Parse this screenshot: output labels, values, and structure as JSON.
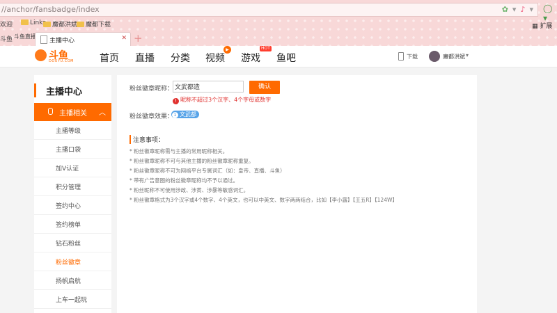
{
  "browser": {
    "address": "//anchor/fansbadge/index",
    "star_icon": "star-icon",
    "bookmarks": [
      {
        "label": "欢迎"
      },
      {
        "label": "Links"
      },
      {
        "label": "魔都洪斌"
      },
      {
        "label": "魔都下载"
      }
    ],
    "extensions_label": "扩展",
    "tabs": [
      {
        "label": "斗鱼"
      },
      {
        "label": "斗鱼直播"
      },
      {
        "label": "主播中心"
      }
    ]
  },
  "site": {
    "logo": {
      "main": "斗鱼",
      "sub": "DOUYU.COM"
    },
    "nav": [
      {
        "label": "首页"
      },
      {
        "label": "直播"
      },
      {
        "label": "分类"
      },
      {
        "label": "视频"
      },
      {
        "label": "游戏"
      },
      {
        "label": "鱼吧"
      }
    ],
    "hot_badge": "HOT",
    "download_label": "下载",
    "user_name": "魔都洪斌"
  },
  "sidebar": {
    "title": "主播中心",
    "section": "主播相关",
    "items": [
      {
        "label": "主播等级"
      },
      {
        "label": "主播口袋"
      },
      {
        "label": "加V认证"
      },
      {
        "label": "积分管理"
      },
      {
        "label": "签约中心"
      },
      {
        "label": "签约榜单"
      },
      {
        "label": "钻石粉丝"
      },
      {
        "label": "粉丝徽章"
      },
      {
        "label": "扬帆启航"
      },
      {
        "label": "上车一起玩"
      }
    ]
  },
  "form": {
    "name_label": "粉丝徽章昵称：",
    "name_value": "文武都造",
    "confirm_label": "确认",
    "warning": "昵称不超过3个汉字、4个字母或数字",
    "effect_label": "粉丝徽章效果：",
    "badge_level": "1",
    "badge_text": "文武都"
  },
  "notes": {
    "title": "注意事项：",
    "items": [
      "* 粉丝徽章昵称需与主播的常用昵称相关。",
      "* 粉丝徽章昵称不可与其他主播的粉丝徽章昵称重复。",
      "* 粉丝徽章昵称不可为网络平台专属词汇（如：皇帝、直播、斗鱼）",
      "* 带有广告意图的粉丝徽章昵称均不予以通过。",
      "* 粉丝昵称不可使用涉政、涉黄、涉暴等敏感词汇。",
      "* 粉丝徽章格式为3个汉字或4个数字、4个英文，也可以中英文、数字两两结合，比如【李小露】【王五R】【124W】"
    ]
  },
  "colors": {
    "accent": "#ff6a00",
    "warning": "#e0312f",
    "badge": "#57a3e8"
  }
}
